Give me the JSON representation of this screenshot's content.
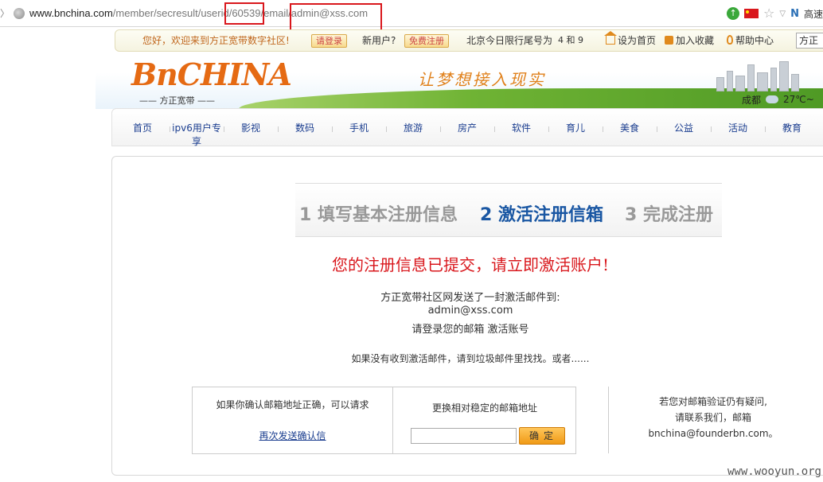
{
  "browser": {
    "url_domain": "www.bnchina.com",
    "url_path": "/member/secresult/userid/60539/email/admin@xss.com",
    "user_label": "高速"
  },
  "topbar": {
    "welcome": "您好，欢迎来到方正宽带数字社区!",
    "login_button": "请登录",
    "new_user": "新用户?",
    "register_button": "免费注册",
    "traffic": "北京今日限行尾号为",
    "traffic_nums": "4 和 9",
    "set_home": "设为首页",
    "add_fav": "加入收藏",
    "help": "帮助中心",
    "brand_select": "方正"
  },
  "banner": {
    "logo": "BnCHINA",
    "logo_sub": "—— 方正宽带 ——",
    "slogan": "让梦想接入现实",
    "city": "成都",
    "temp": "27℃~"
  },
  "nav": [
    "首页",
    "ipv6用户专享",
    "影视",
    "数码",
    "手机",
    "旅游",
    "房产",
    "软件",
    "育儿",
    "美食",
    "公益",
    "活动",
    "教育"
  ],
  "steps": {
    "s1": "1 填写基本注册信息",
    "s2": "2 激活注册信箱",
    "s3": "3 完成注册"
  },
  "content": {
    "headline": "您的注册信息已提交，请立即激活账户!",
    "line1": "方正宽带社区网发送了一封激活邮件到:",
    "email": "admin@xss.com",
    "line3": "请登录您的邮箱 激活账号",
    "note": "如果没有收到激活邮件，请到垃圾邮件里找找。或者......",
    "confirm_text": "如果你确认邮箱地址正确，可以请求",
    "resend_link": "再次发送确认信",
    "change_text": "更换相对稳定的邮箱地址",
    "ok_button": "确定",
    "contact1": "若您对邮箱验证仍有疑问,",
    "contact2": "请联系我们，邮箱",
    "contact3": "bnchina@founderbn.com。"
  },
  "watermark": "www.wooyun.org",
  "colors": {
    "highlight_box": "#d9171c",
    "link": "#1a3d8f",
    "active_step": "#1a57a3",
    "accent_orange": "#e56a13"
  }
}
